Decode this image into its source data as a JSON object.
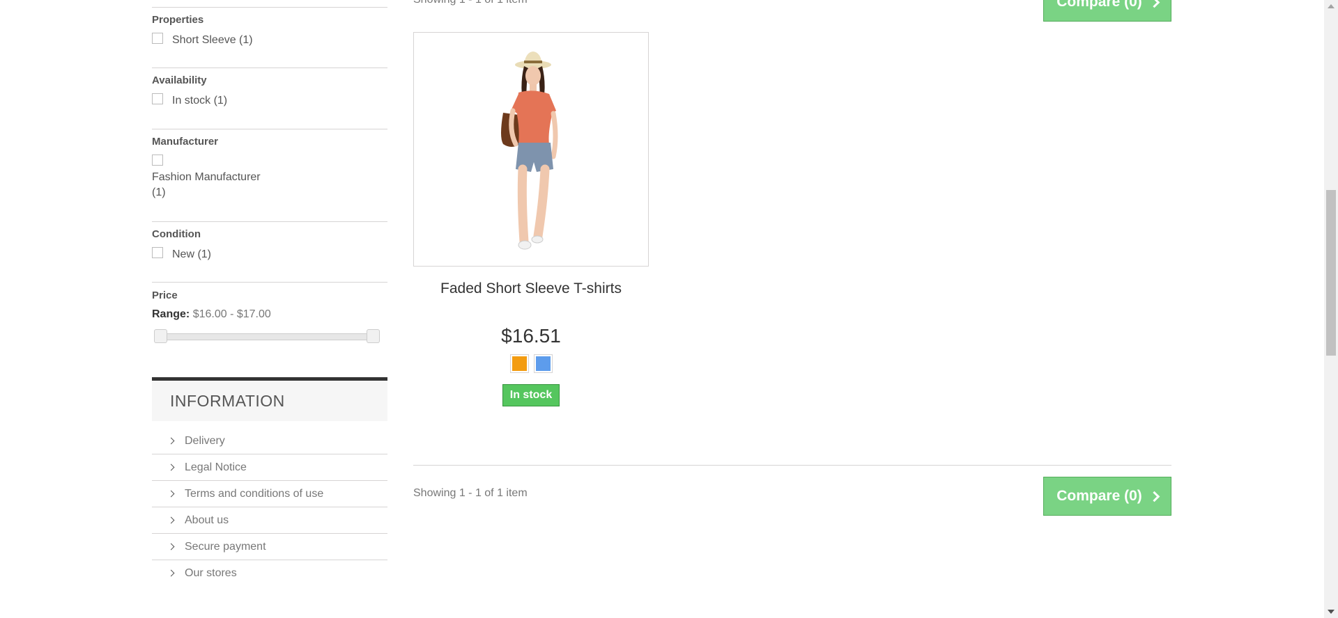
{
  "filters": {
    "properties": {
      "title": "Properties",
      "option": "Short Sleeve (1)"
    },
    "availability": {
      "title": "Availability",
      "option": "In stock (1)"
    },
    "manufacturer": {
      "title": "Manufacturer",
      "option_line1": "Fashion Manufacturer",
      "option_line2": "(1)"
    },
    "condition": {
      "title": "Condition",
      "option": "New (1)"
    },
    "price": {
      "title": "Price",
      "range_label": "Range:",
      "range_value": "$16.00 - $17.00",
      "min": 16.0,
      "max": 17.0,
      "selected_min": 16.0,
      "selected_max": 17.0
    }
  },
  "information": {
    "title": "INFORMATION",
    "items": [
      {
        "label": "Delivery"
      },
      {
        "label": "Legal Notice"
      },
      {
        "label": "Terms and conditions of use"
      },
      {
        "label": "About us"
      },
      {
        "label": "Secure payment"
      },
      {
        "label": "Our stores"
      }
    ]
  },
  "listing": {
    "showing_text": "Showing 1 - 1 of 1 item",
    "compare_label": "Compare (0)"
  },
  "product": {
    "name": "Faded Short Sleeve T-shirts",
    "price": "$16.51",
    "colors": [
      "#f39c11",
      "#5d9cec"
    ],
    "stock": "In stock"
  },
  "colors": {
    "compare_button": "#6fd07a",
    "in_stock_badge": "#55c65e",
    "info_border": "#333333"
  }
}
